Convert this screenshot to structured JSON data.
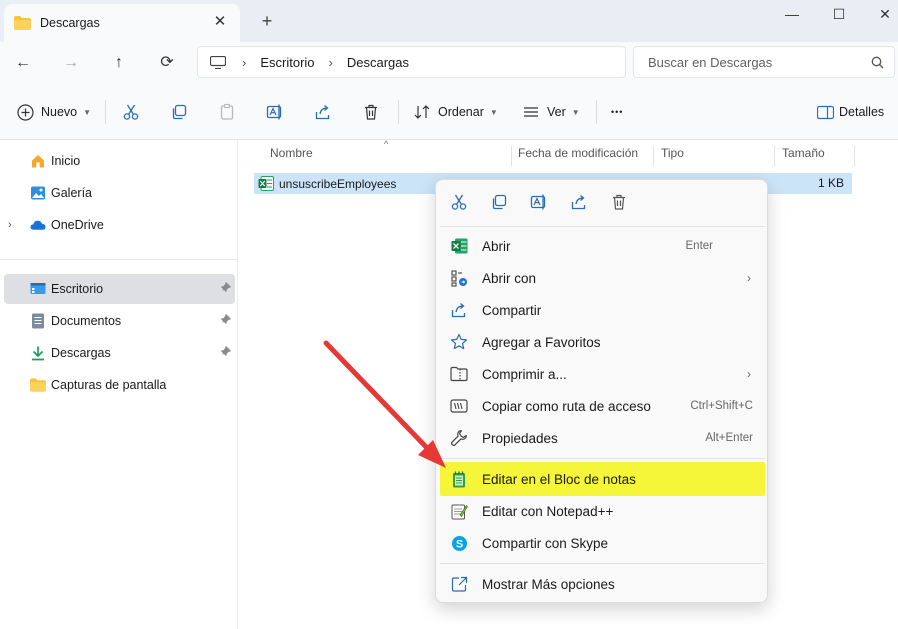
{
  "window": {
    "tab_title": "Descargas",
    "new_tab_glyph": "+",
    "close_tab_glyph": "✕",
    "minimize_glyph": "—",
    "maximize_glyph": "☐",
    "close_glyph": "✕"
  },
  "nav": {
    "back_glyph": "←",
    "forward_glyph": "→",
    "up_glyph": "↑",
    "refresh_glyph": "⟳",
    "breadcrumb": [
      "Escritorio",
      "Descargas"
    ],
    "breadcrumb_sep": "›",
    "search_placeholder": "Buscar en Descargas"
  },
  "commandbar": {
    "new_label": "Nuevo",
    "sort_label": "Ordenar",
    "view_label": "Ver",
    "more_label": "•••",
    "details_label": "Detalles"
  },
  "sidebar": {
    "items": [
      {
        "label": "Inicio",
        "icon": "home-icon"
      },
      {
        "label": "Galería",
        "icon": "gallery-icon"
      },
      {
        "label": "OneDrive",
        "icon": "onedrive-icon"
      },
      {
        "label": "Escritorio",
        "icon": "desktop-icon",
        "selected": true
      },
      {
        "label": "Documentos",
        "icon": "documents-icon"
      },
      {
        "label": "Descargas",
        "icon": "downloads-icon"
      },
      {
        "label": "Capturas de pantalla",
        "icon": "folder-icon"
      }
    ],
    "expander_glyph": "›",
    "pin_glyph": "📌"
  },
  "filelist": {
    "columns": [
      "Nombre",
      "Fecha de modificación",
      "Tipo",
      "Tamaño"
    ],
    "sort_glyph": "^",
    "rows": [
      {
        "name": "unsuscribeEmployees",
        "size": "1 KB",
        "icon": "excel-icon"
      }
    ]
  },
  "context_menu": {
    "toolbar": [
      "cut-icon",
      "copy-icon",
      "rename-icon",
      "share-icon",
      "delete-icon"
    ],
    "items": [
      {
        "label": "Abrir",
        "shortcut": "Enter",
        "icon": "excel-icon"
      },
      {
        "label": "Abrir con",
        "submenu": "›",
        "icon": "open-with-icon"
      },
      {
        "label": "Compartir",
        "icon": "share-icon"
      },
      {
        "label": "Agregar a Favoritos",
        "icon": "star-icon"
      },
      {
        "label": "Comprimir a...",
        "submenu": "›",
        "icon": "zip-icon"
      },
      {
        "label": "Copiar como ruta de acceso",
        "shortcut": "Ctrl+Shift+C",
        "icon": "path-icon"
      },
      {
        "label": "Propiedades",
        "shortcut": "Alt+Enter",
        "icon": "wrench-icon"
      },
      {
        "label": "Editar en el Bloc de notas",
        "icon": "notepad-icon",
        "highlight": true
      },
      {
        "label": "Editar con Notepad++",
        "icon": "notepadpp-icon"
      },
      {
        "label": "Compartir con Skype",
        "icon": "skype-icon"
      },
      {
        "label": "Mostrar Más opciones",
        "icon": "more-options-icon"
      }
    ]
  },
  "colors": {
    "accent": "#0067c0",
    "highlight": "#f5f53a",
    "selection": "#cce4f7",
    "arrow": "#e53935",
    "excel_green": "#107c41"
  }
}
